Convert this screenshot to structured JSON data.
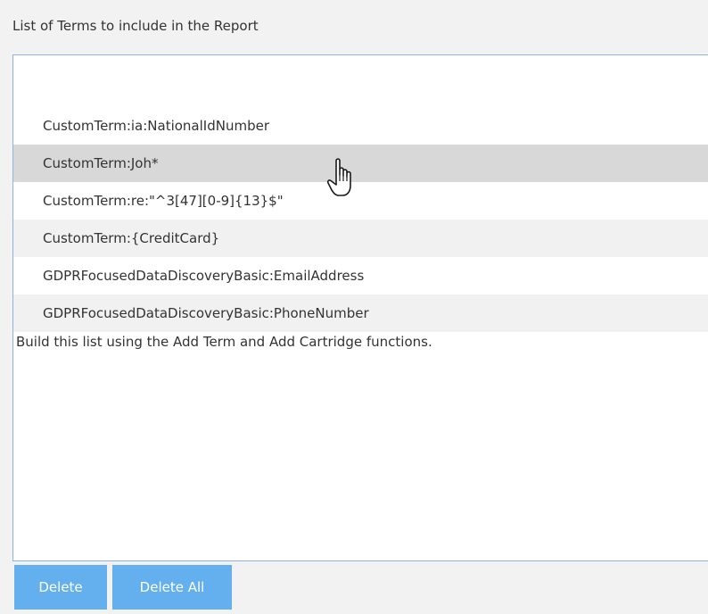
{
  "panel": {
    "title": "List of Terms to include in the Report"
  },
  "terms": {
    "items": [
      "CustomTerm:ia:NationalIdNumber",
      "CustomTerm:Joh*",
      "CustomTerm:re:\"^3[47][0-9]{13}$\"",
      "CustomTerm:{CreditCard}",
      "GDPRFocusedDataDiscoveryBasic:EmailAddress",
      "GDPRFocusedDataDiscoveryBasic:PhoneNumber"
    ],
    "hint": "Build this list using the Add Term and Add Cartridge functions."
  },
  "buttons": {
    "delete_label": "Delete",
    "delete_all_label": "Delete All"
  },
  "cursor": {
    "icon": "hand-pointer-icon"
  },
  "colors": {
    "button_bg": "#64b0ee",
    "hover_row": "#d8d8d8",
    "alt_row": "#f1f1f1",
    "border": "#8fb3d9"
  }
}
